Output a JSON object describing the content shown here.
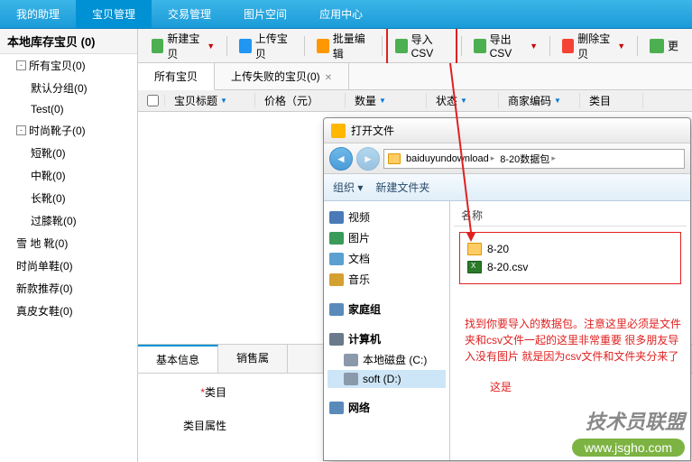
{
  "nav": [
    {
      "label": "我的助理"
    },
    {
      "label": "宝贝管理",
      "active": true
    },
    {
      "label": "交易管理"
    },
    {
      "label": "图片空间"
    },
    {
      "label": "应用中心"
    }
  ],
  "sidebar": {
    "title": "本地库存宝贝 (0)",
    "items": [
      {
        "label": "所有宝贝(0)",
        "expand": "-",
        "level": 1
      },
      {
        "label": "默认分组(0)",
        "level": 2
      },
      {
        "label": "Test(0)",
        "level": 2
      },
      {
        "label": "时尚靴子(0)",
        "expand": "-",
        "level": 1
      },
      {
        "label": "短靴(0)",
        "level": 2
      },
      {
        "label": "中靴(0)",
        "level": 2
      },
      {
        "label": "长靴(0)",
        "level": 2
      },
      {
        "label": "过膝靴(0)",
        "level": 2
      },
      {
        "label": "雪 地 靴(0)",
        "level": 1
      },
      {
        "label": "时尚单鞋(0)",
        "level": 1
      },
      {
        "label": "新款推荐(0)",
        "level": 1
      },
      {
        "label": "真皮女鞋(0)",
        "level": 1
      }
    ]
  },
  "toolbar": {
    "new": "新建宝贝",
    "upload": "上传宝贝",
    "batch": "批量编辑",
    "import": "导入CSV",
    "export": "导出CSV",
    "delete": "删除宝贝",
    "more": "更"
  },
  "tabs": [
    {
      "label": "所有宝贝",
      "active": true
    },
    {
      "label": "上传失败的宝贝(0)"
    }
  ],
  "columns": {
    "title": "宝贝标题",
    "price": "价格（元）",
    "qty": "数量",
    "status": "状态",
    "code": "商家编码",
    "cat": "类目"
  },
  "detail_tabs": [
    {
      "label": "基本信息",
      "active": true
    },
    {
      "label": "销售属"
    }
  ],
  "form": {
    "cat_label": "类目",
    "cat_attr_label": "类目属性"
  },
  "dialog": {
    "title": "打开文件",
    "breadcrumb": [
      "baiduyundownload",
      "8-20数据包"
    ],
    "organize": "组织",
    "newfolder": "新建文件夹",
    "tree": [
      {
        "label": "视频",
        "color": "#4a7ab8"
      },
      {
        "label": "图片",
        "color": "#3a9a5a"
      },
      {
        "label": "文档",
        "color": "#5aa0d0"
      },
      {
        "label": "音乐",
        "color": "#d4a030"
      },
      {
        "label": "",
        "spacer": true
      },
      {
        "label": "家庭组",
        "color": "#5a8aba",
        "bold": true
      },
      {
        "label": "",
        "spacer": true
      },
      {
        "label": "计算机",
        "color": "#6a7a8a",
        "bold": true
      },
      {
        "label": "本地磁盘 (C:)",
        "color": "#8a9aaa",
        "sub": true
      },
      {
        "label": "soft (D:)",
        "color": "#8a9aaa",
        "sub": true,
        "selected": true
      },
      {
        "label": "",
        "spacer": true
      },
      {
        "label": "网络",
        "color": "#5a8aba",
        "bold": true
      }
    ],
    "file_header": "名称",
    "files": [
      {
        "name": "8-20",
        "type": "folder"
      },
      {
        "name": "8-20.csv",
        "type": "csv"
      }
    ]
  },
  "annotation": "找到你要导入的数据包。注意这里必须是文件夹和csv文件一起的这里非常重要  很多朋友导入没有图片 就是因为csv文件和文件夹分来了",
  "annotation2": "这是",
  "watermark": "技术员联盟",
  "watermark_url": "www.jsgho.com"
}
